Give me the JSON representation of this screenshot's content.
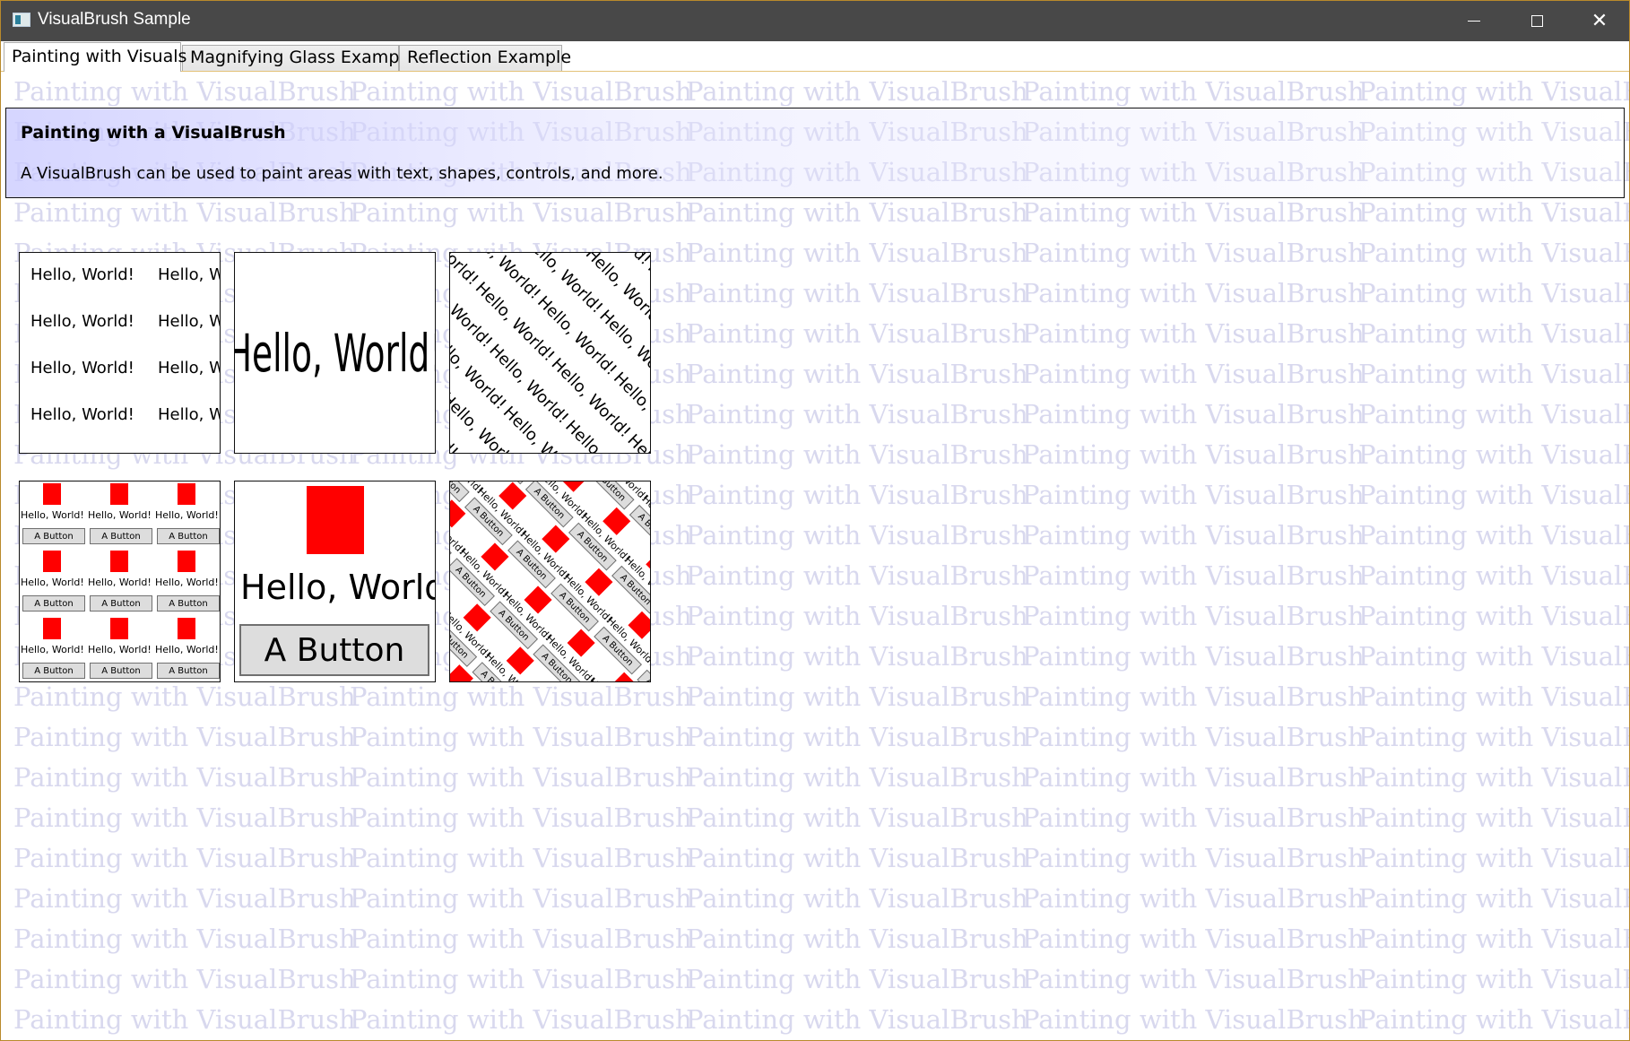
{
  "window": {
    "title": "VisualBrush Sample",
    "controls": {
      "minimize": "—",
      "maximize": "☐",
      "close": "✕"
    }
  },
  "tabs": [
    {
      "label": "Painting with Visuals",
      "active": true
    },
    {
      "label": "Magnifying Glass Example",
      "active": false
    },
    {
      "label": "Reflection Example",
      "active": false
    }
  ],
  "background_text": "Painting with VisualBrush",
  "header": {
    "title": "Painting with a VisualBrush",
    "description": "A VisualBrush can be used to paint areas with text, shapes, controls, and more."
  },
  "samples": {
    "hello_text": "Hello, World!",
    "button_text": "A Button"
  },
  "colors": {
    "titlebar": "#484848",
    "accent_red": "#ff0000",
    "background_watermark": "#d8d8ee"
  }
}
